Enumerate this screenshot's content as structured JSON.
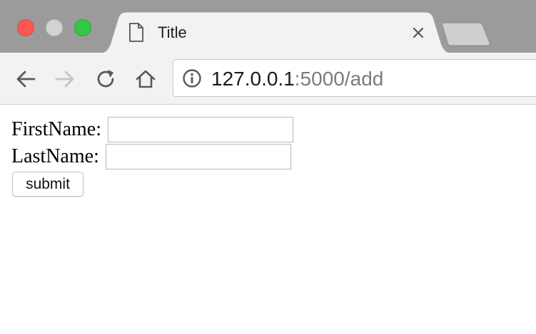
{
  "tab": {
    "title": "Title",
    "close_icon": "close-icon",
    "page_icon": "document-icon"
  },
  "window_controls": [
    "close",
    "minimize",
    "maximize"
  ],
  "toolbar": {
    "back_icon": "arrow-left-icon",
    "forward_icon": "arrow-right-icon",
    "reload_icon": "reload-icon",
    "home_icon": "home-icon"
  },
  "address_bar": {
    "info_icon": "info-icon",
    "host": "127.0.0.1",
    "rest": ":5000/add"
  },
  "form": {
    "first_name_label": "FirstName:",
    "first_name_value": "",
    "last_name_label": "LastName:",
    "last_name_value": "",
    "submit_label": "submit"
  },
  "colors": {
    "tabstrip": "#9b9b9b",
    "close": "#fc5753",
    "minimize": "#d2d2d2",
    "maximize": "#33c748"
  }
}
